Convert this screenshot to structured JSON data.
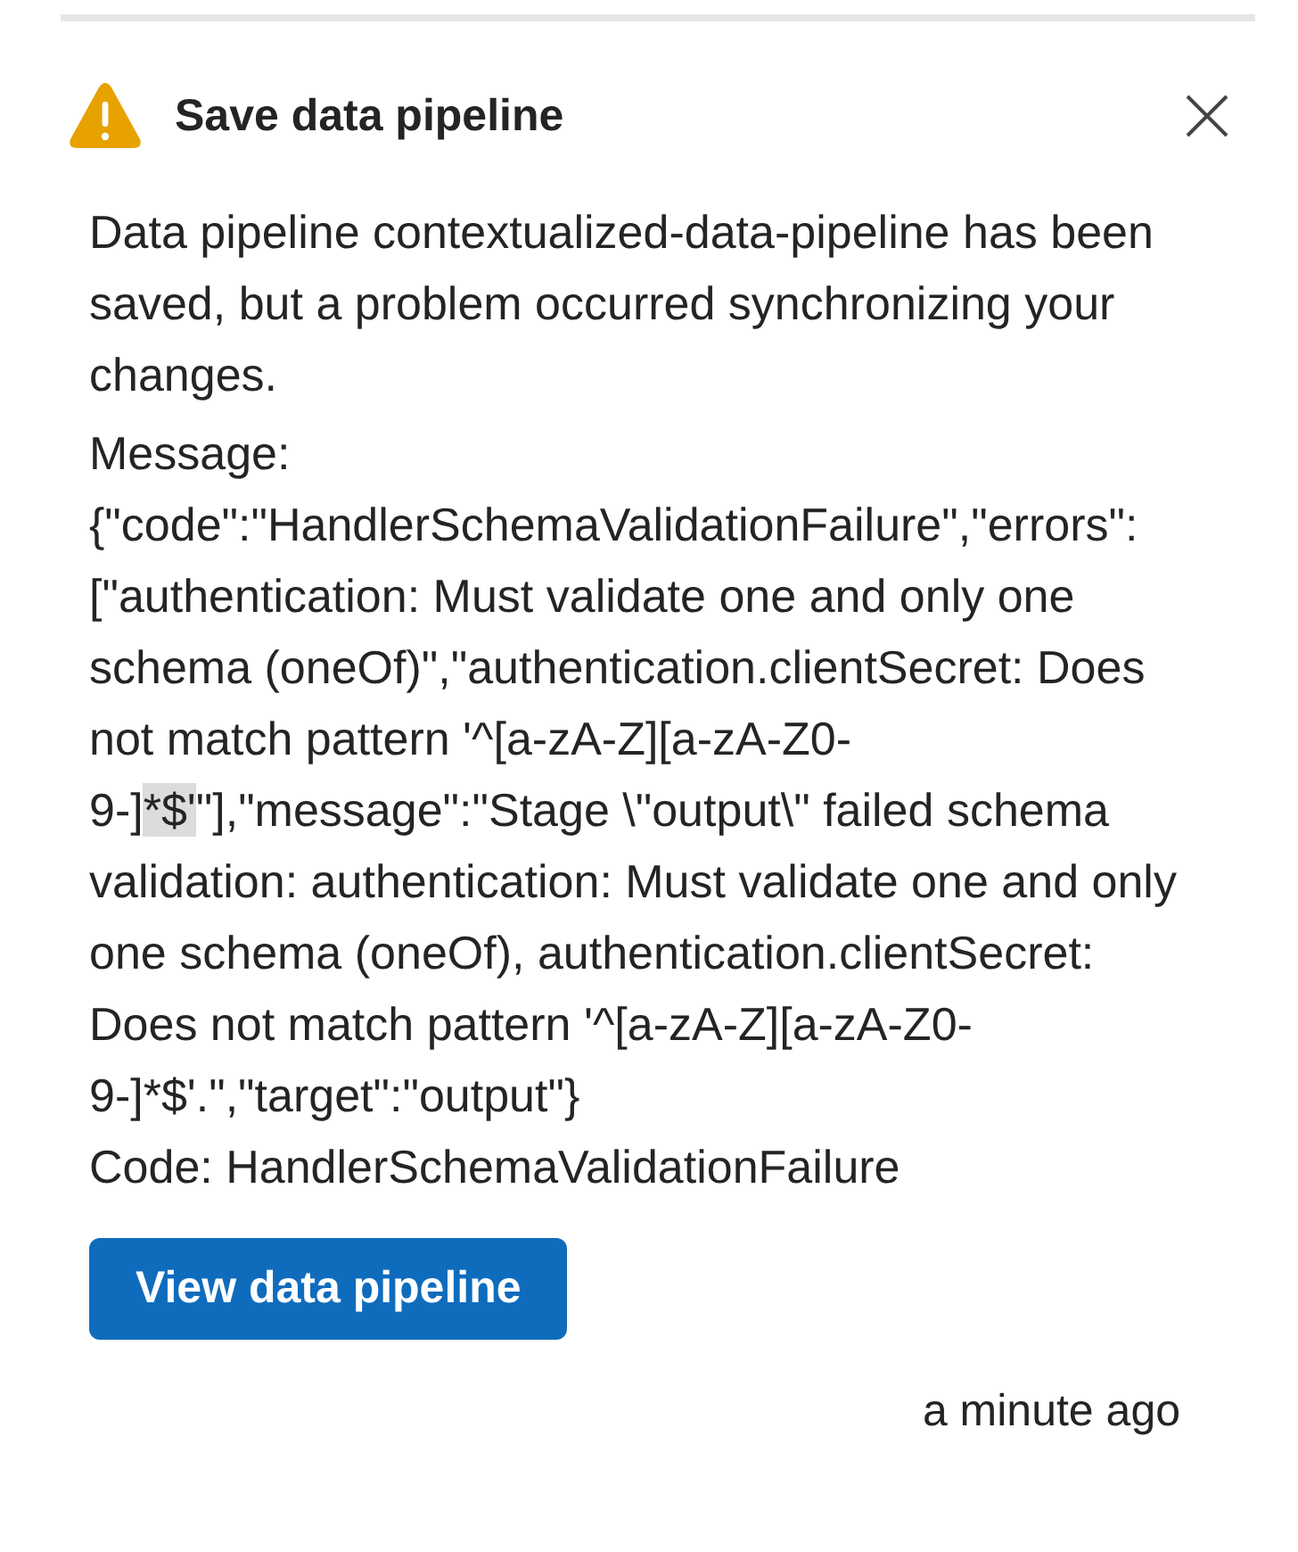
{
  "notification": {
    "kind": "warning",
    "title": "Save data pipeline",
    "summary": "Data pipeline contextualized-data-pipeline has been saved, but a problem occurred synchronizing your changes.",
    "message_label": "Message:",
    "message_parts": [
      {
        "text": "{\"code\":\"HandlerSchemaValidationFailure\",\"errors\":[\"authentication: Must validate one and only one schema (oneOf)\",\"authentication.clientSecret: Does not match pattern '^[a-zA-Z][a-zA-Z0-9-]",
        "highlighted": false
      },
      {
        "text": "*$'",
        "highlighted": true
      },
      {
        "text": "\"],\"message\":\"Stage \\\"output\\\" failed schema validation: authentication: Must validate one and only one schema (oneOf), authentication.clientSecret: Does not match pattern '^[a-zA-Z][a-zA-Z0-9-]*$'.\",\"target\":\"output\"}",
        "highlighted": false
      }
    ],
    "code_line": "Code: HandlerSchemaValidationFailure",
    "action": "View data pipeline",
    "time": "a minute ago"
  }
}
